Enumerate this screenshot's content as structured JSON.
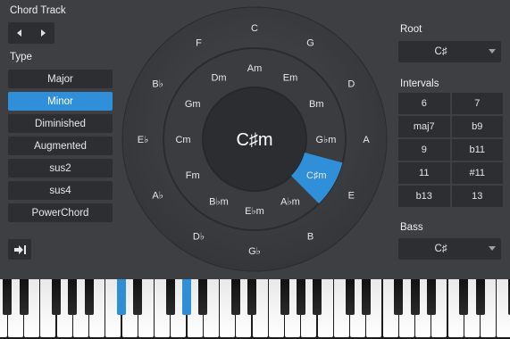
{
  "chord_track": {
    "title": "Chord Track"
  },
  "type_section": {
    "title": "Type",
    "items": [
      "Major",
      "Minor",
      "Diminished",
      "Augmented",
      "sus2",
      "sus4",
      "PowerChord"
    ],
    "selected": "Minor"
  },
  "root": {
    "title": "Root",
    "value": "C♯"
  },
  "intervals": {
    "title": "Intervals",
    "items": [
      "6",
      "7",
      "maj7",
      "b9",
      "9",
      "b11",
      "11",
      "#11",
      "b13",
      "13"
    ]
  },
  "bass": {
    "title": "Bass",
    "value": "C♯"
  },
  "wheel": {
    "center": "C♯m",
    "outer": [
      "C",
      "G",
      "D",
      "A",
      "E",
      "B",
      "G♭",
      "D♭",
      "A♭",
      "E♭",
      "B♭",
      "F"
    ],
    "inner": [
      "Am",
      "Em",
      "Bm",
      "G♭m",
      "C♯m",
      "A♭m",
      "E♭m",
      "B♭m",
      "Fm",
      "Cm",
      "Gm",
      "Dm"
    ],
    "selected_inner": "C♯m"
  },
  "colors": {
    "accent": "#2f8fd8",
    "panel": "#2c2e31",
    "background": "#3d3f42"
  },
  "icons": [
    "arrow-left-icon",
    "arrow-right-icon",
    "dropdown-arrow-icon",
    "send-to-track-icon"
  ],
  "keyboard": {
    "active_keys": [
      "C♯",
      "E",
      "G♯"
    ]
  }
}
